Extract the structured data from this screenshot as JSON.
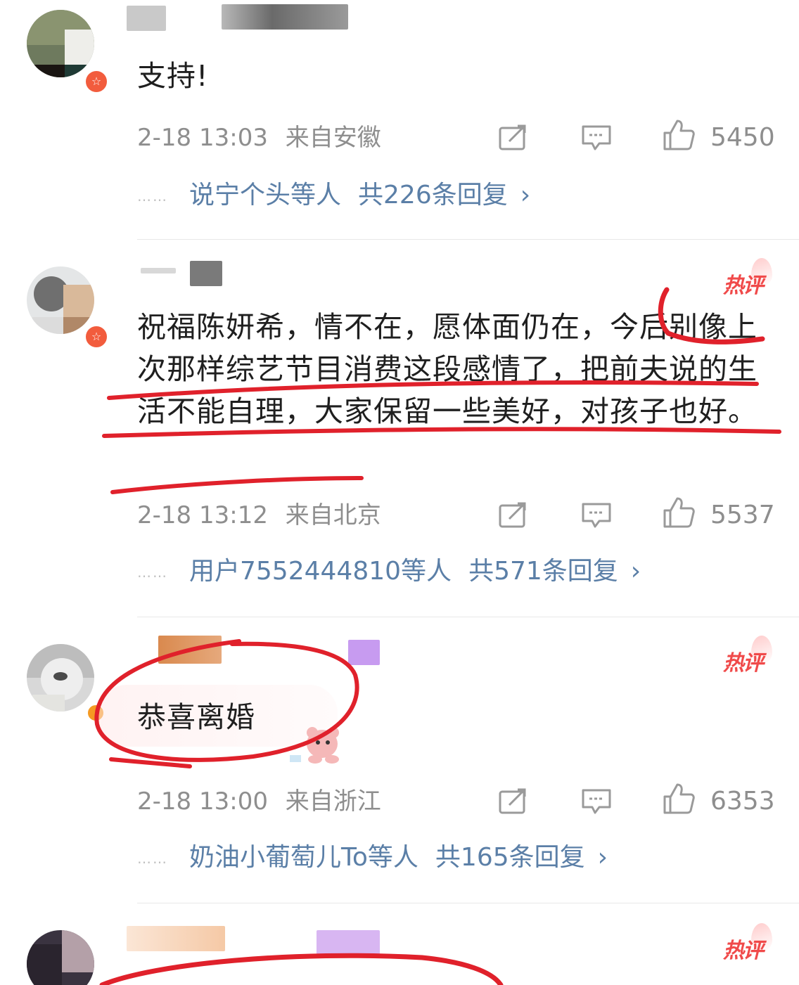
{
  "comments": [
    {
      "text": "支持!",
      "time": "2-18 13:03",
      "location": "来自安徽",
      "likes": "5450",
      "reply_names": "说宁个头",
      "reply_suffix": "等人",
      "reply_count": "共226条回复",
      "hot": false
    },
    {
      "text": "祝福陈妍希，情不在，愿体面仍在，今后别像上次那样综艺节目消费这段感情了，把前夫说的生活不能自理，大家保留一些美好，对孩子也好。",
      "time": "2-18 13:12",
      "location": "来自北京",
      "likes": "5537",
      "reply_names": "用户7552444810",
      "reply_suffix": "等人",
      "reply_count": "共571条回复",
      "hot": true,
      "hot_label": "热评"
    },
    {
      "text": "恭喜离婚",
      "time": "2-18 13:00",
      "location": "来自浙江",
      "likes": "6353",
      "reply_names": "奶油小葡萄儿To",
      "reply_suffix": "等人",
      "reply_count": "共165条回复",
      "hot": true,
      "hot_label": "热评"
    },
    {
      "hot": true,
      "hot_label": "热评"
    }
  ],
  "dots": "……",
  "chevron": "›",
  "icons": {
    "share": "share-icon",
    "comment": "comment-icon",
    "like": "like-icon"
  },
  "colors": {
    "link": "#5b7fa7",
    "meta": "#8e8e8e",
    "hot": "#f04a4a",
    "annotation": "#e0212b"
  }
}
